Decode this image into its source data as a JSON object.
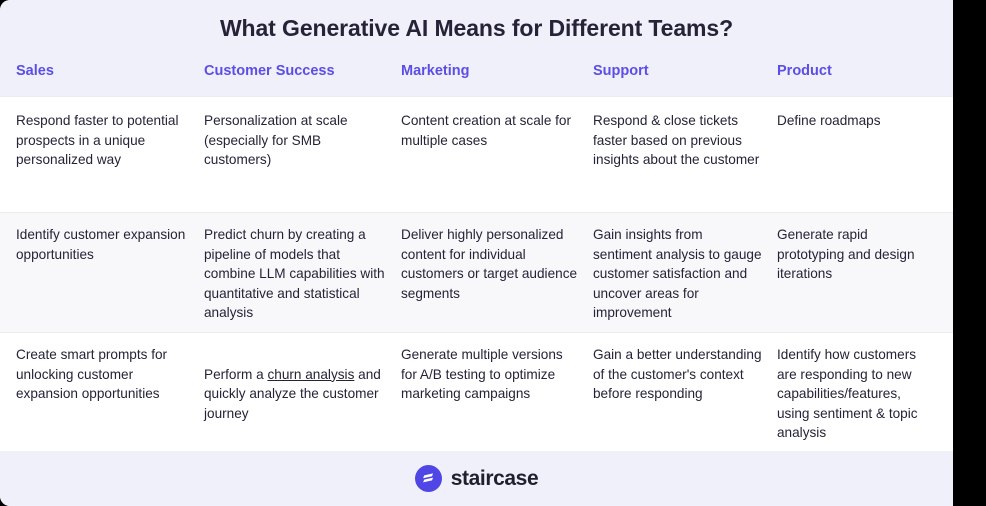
{
  "title": "What Generative AI Means for Different Teams?",
  "columns": [
    {
      "label": "Sales"
    },
    {
      "label": "Customer Success"
    },
    {
      "label": "Marketing"
    },
    {
      "label": "Support"
    },
    {
      "label": "Product"
    }
  ],
  "rows": [
    [
      "Respond faster to potential prospects in a unique personalized way",
      "Personalization at scale (especially for SMB customers)",
      "Content creation at scale for multiple cases",
      "Respond & close tickets faster based on previous insights about the customer",
      "Define roadmaps"
    ],
    [
      "Identify customer expansion opportunities",
      "Predict churn by creating a pipeline of models that combine LLM capabilities with quantitative and statistical analysis",
      "Deliver highly personalized content for individual customers or target audience segments",
      "Gain insights from sentiment analysis to gauge customer satisfaction and uncover areas for improvement",
      "Generate rapid prototyping and design iterations"
    ],
    [
      "Create smart prompts for unlocking customer expansion opportunities",
      {
        "pre": "Perform a ",
        "link": "churn analysis",
        "post": " and quickly analyze the customer journey"
      },
      "Generate multiple versions for A/B testing to optimize marketing campaigns",
      "Gain a better understanding of the customer's context before responding",
      "Identify how customers are responding to new capabilities/features, using sentiment & topic analysis"
    ]
  ],
  "footer": {
    "logo_name": "staircase-logo",
    "wordmark": "staircase"
  },
  "colors": {
    "accent": "#5b4ee6",
    "logo_circle": "#4f46e5",
    "band_background": "#f0f0fa",
    "row_alt_background": "#f8f8fa",
    "text": "#262338",
    "right_band": "#000000"
  }
}
